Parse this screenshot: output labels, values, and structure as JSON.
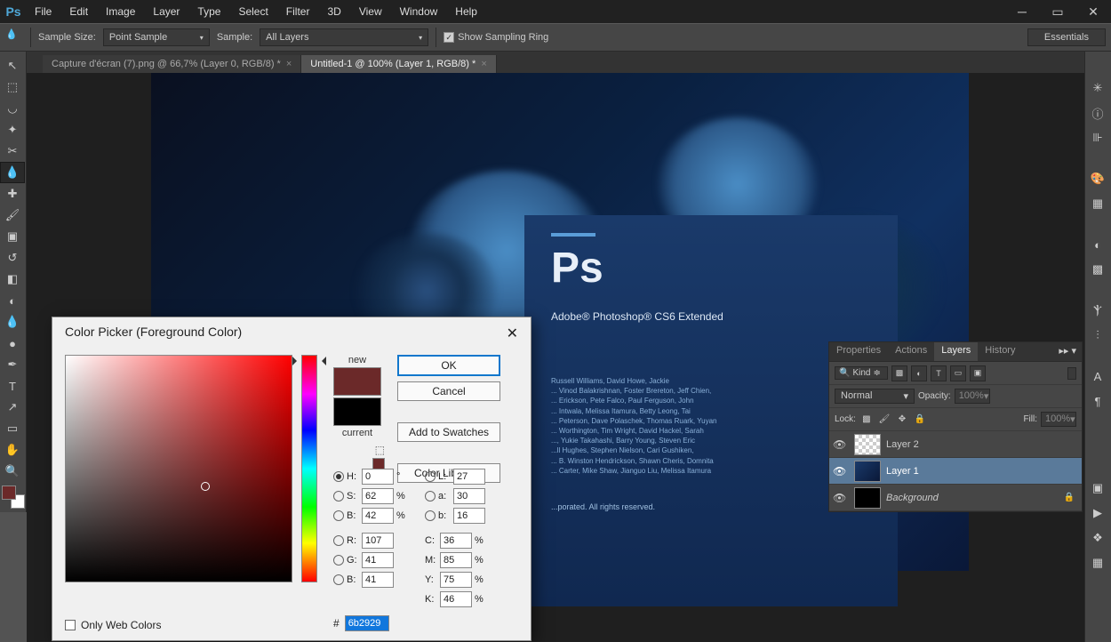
{
  "menubar": [
    "File",
    "Edit",
    "Image",
    "Layer",
    "Type",
    "Select",
    "Filter",
    "3D",
    "View",
    "Window",
    "Help"
  ],
  "options": {
    "sample_size_label": "Sample Size:",
    "sample_size_value": "Point Sample",
    "sample_label": "Sample:",
    "sample_value": "All Layers",
    "show_ring": "Show Sampling Ring",
    "workspace": "Essentials"
  },
  "tabs": [
    {
      "title": "Capture d'écran (7).png @ 66,7% (Layer 0, RGB/8) *",
      "active": false
    },
    {
      "title": "Untitled-1 @ 100% (Layer 1, RGB/8) *",
      "active": true
    }
  ],
  "splash": {
    "title": "Adobe® Photoshop® CS6 Extended",
    "credits": "Russell Williams, David Howe, Jackie\n... Vinod Balakrishnan, Foster Brereton, Jeff Chien,\n... Erickson, Pete Falco, Paul Ferguson, John\n... Intwala, Melissa Itamura, Betty Leong, Tai\n... Peterson, Dave Polaschek, Thomas Ruark, Yuyan\n... Worthington, Tim Wright, David Hackel, Sarah\n..., Yukie Takahashi, Barry Young, Steven Eric\n...ll Hughes, Stephen Nielson, Cari Gushiken,\n... B. Winston Hendrickson, Shawn Cheris, Domnita\n... Carter, Mike Shaw, Jianguo Liu, Melissa Itamura",
    "copyright": "...porated. All rights reserved."
  },
  "panel": {
    "tabs": [
      "Properties",
      "Actions",
      "Layers",
      "History"
    ],
    "active": "Layers",
    "kind": "Kind",
    "blend": "Normal",
    "opacity_label": "Opacity:",
    "opacity_value": "100%",
    "lock_label": "Lock:",
    "fill_label": "Fill:",
    "fill_value": "100%",
    "layers": [
      {
        "name": "Layer 2",
        "sel": false,
        "bg": false,
        "thumb": "checker"
      },
      {
        "name": "Layer 1",
        "sel": true,
        "bg": false,
        "thumb": "img"
      },
      {
        "name": "Background",
        "sel": false,
        "bg": true,
        "thumb": "dark"
      }
    ]
  },
  "dialog": {
    "title": "Color Picker (Foreground Color)",
    "new_label": "new",
    "current_label": "current",
    "buttons": {
      "ok": "OK",
      "cancel": "Cancel",
      "add": "Add to Swatches",
      "libs": "Color Libraries"
    },
    "H": "0",
    "S": "62",
    "B": "42",
    "L": "27",
    "a": "30",
    "b": "16",
    "R": "107",
    "G": "41",
    "Bv": "41",
    "C": "36",
    "M": "85",
    "Y": "75",
    "K": "46",
    "hex": "6b2929",
    "web": "Only Web Colors",
    "new_color": "#6b2929",
    "current_color": "#000000"
  }
}
